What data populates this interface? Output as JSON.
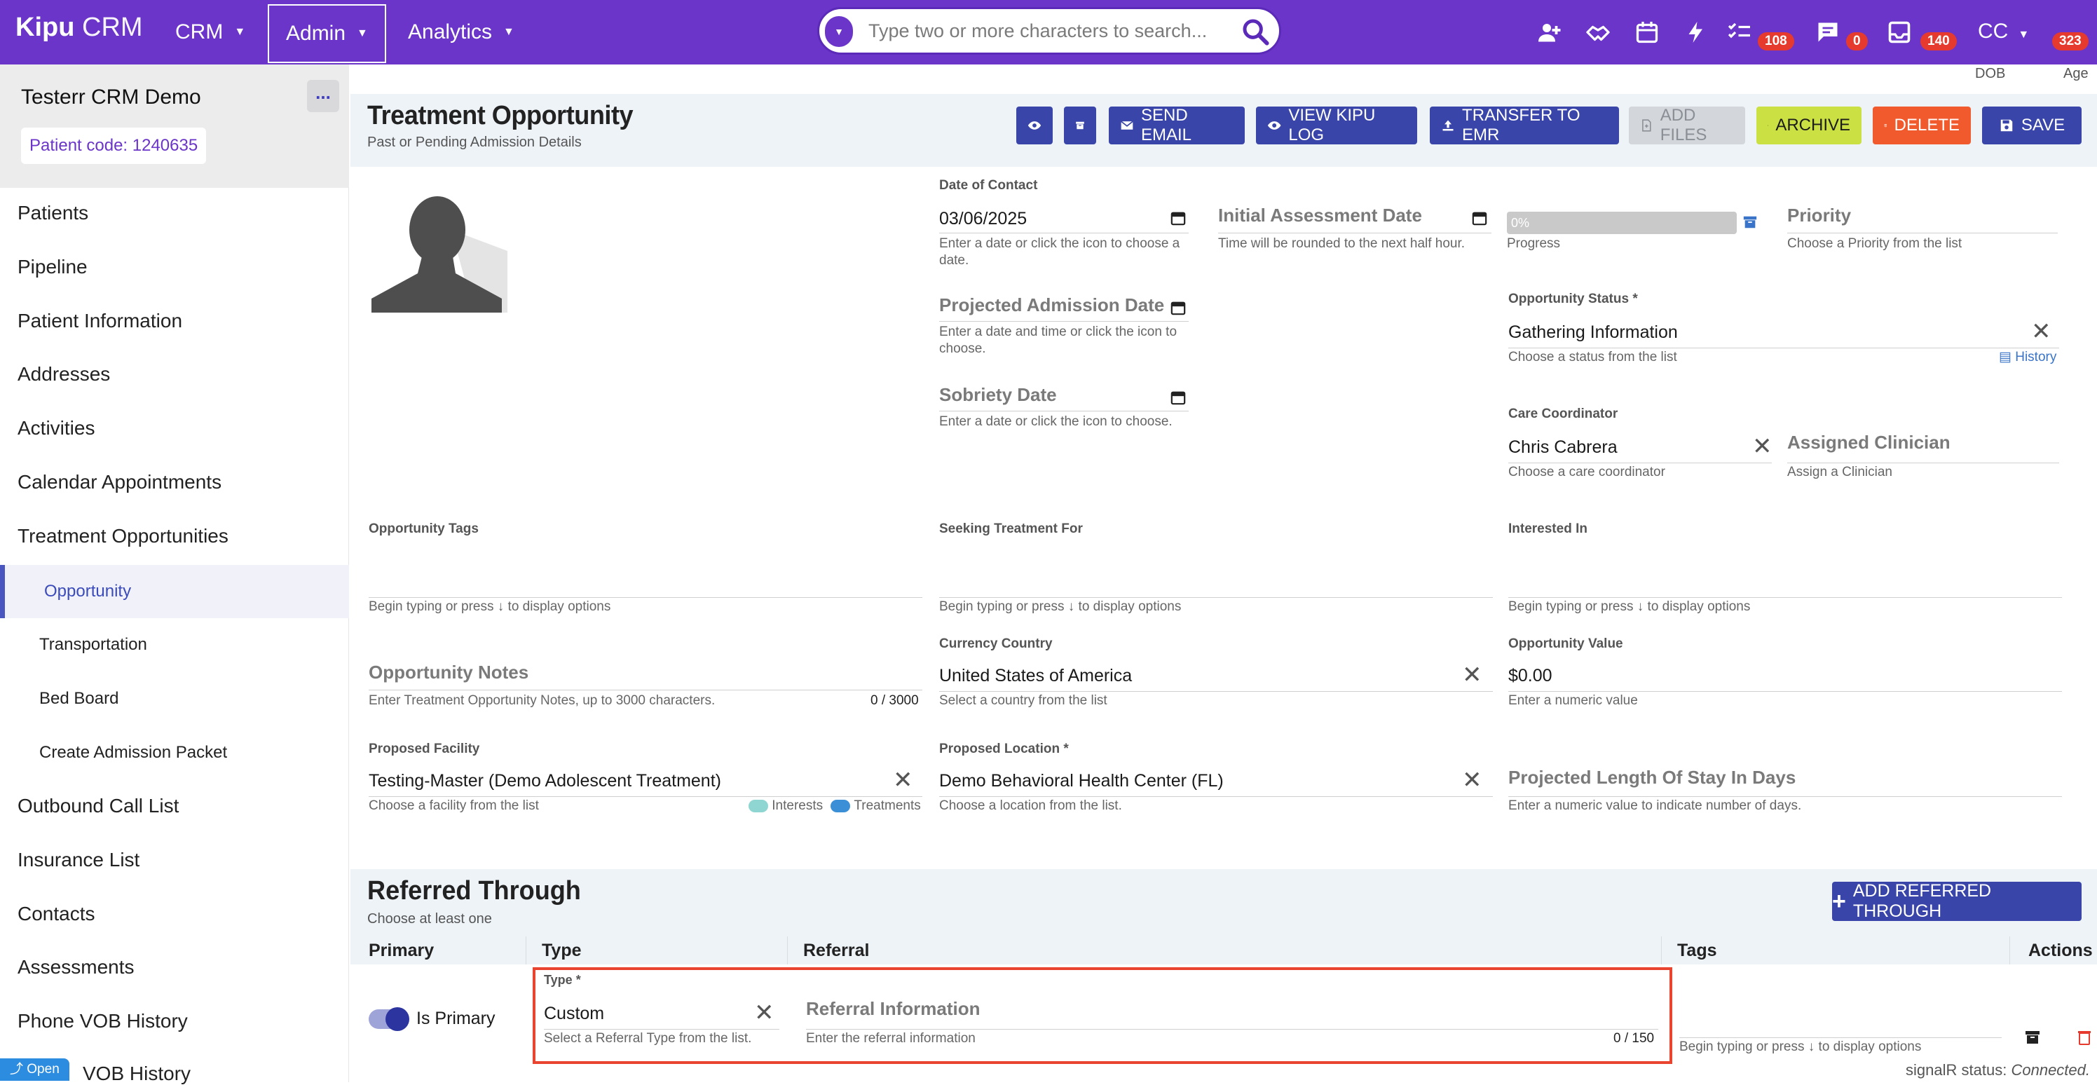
{
  "topbar": {
    "logo_kipu": "Kipu",
    "logo_crm": " CRM",
    "nav": [
      {
        "label": "CRM"
      },
      {
        "label": "Admin"
      },
      {
        "label": "Analytics"
      }
    ],
    "search_placeholder": "Type two or more characters to search...",
    "badges": {
      "tasks": "108",
      "messages": "0",
      "inbox": "140",
      "user": "323"
    },
    "user_initials": "CC"
  },
  "subheader": {
    "dob": "DOB",
    "age": "Age"
  },
  "sidebar": {
    "patient_name": "Testerr CRM Demo",
    "more": "...",
    "patient_code": "Patient code: 1240635",
    "items": [
      "Patients",
      "Pipeline",
      "Patient Information",
      "Addresses",
      "Activities",
      "Calendar Appointments",
      "Treatment Opportunities",
      "Opportunity",
      "Transportation",
      "Bed Board",
      "Create Admission Packet",
      "Outbound Call List",
      "Insurance List",
      "Contacts",
      "Assessments",
      "Phone VOB History",
      "VOB History"
    ],
    "open": "Open"
  },
  "page": {
    "title": "Treatment Opportunity",
    "subtitle": "Past or Pending Admission Details",
    "buttons": {
      "send_email": "SEND EMAIL",
      "view_log": "VIEW KIPU LOG",
      "transfer": "TRANSFER TO EMR",
      "add_files": "ADD FILES",
      "archive": "ARCHIVE",
      "delete": "DELETE",
      "save": "SAVE"
    }
  },
  "form": {
    "date_of_contact": {
      "label": "Date of Contact",
      "value": "03/06/2025",
      "hint": "Enter a date or click the icon to choose a date."
    },
    "initial_assessment": {
      "label": "Initial Assessment Date",
      "hint": "Time will be rounded to the next half hour."
    },
    "progress": {
      "value": "0%",
      "percent": 0,
      "label": "Progress"
    },
    "priority": {
      "label": "Priority",
      "hint": "Choose a Priority from the list"
    },
    "projected_admission": {
      "label": "Projected Admission Date",
      "hint": "Enter a date and time or click the icon to choose."
    },
    "opportunity_status": {
      "label": "Opportunity Status",
      "value": "Gathering Information",
      "hint": "Choose a status from the list",
      "history": "History"
    },
    "sobriety_date": {
      "label": "Sobriety Date",
      "hint": "Enter a date or click the icon to choose."
    },
    "care_coordinator": {
      "label": "Care Coordinator",
      "value": "Chris Cabrera",
      "hint": "Choose a care coordinator"
    },
    "assigned_clinician": {
      "label": "Assigned Clinician",
      "hint": "Assign a Clinician"
    },
    "opportunity_tags": {
      "label": "Opportunity Tags",
      "hint": "Begin typing or press ↓ to display options"
    },
    "seeking_treatment": {
      "label": "Seeking Treatment For",
      "hint": "Begin typing or press ↓ to display options"
    },
    "interested_in": {
      "label": "Interested In",
      "hint": "Begin typing or press ↓ to display options"
    },
    "opportunity_notes": {
      "label": "Opportunity Notes",
      "hint": "Enter Treatment Opportunity Notes, up to 3000 characters.",
      "count": "0 / 3000"
    },
    "currency_country": {
      "label": "Currency Country",
      "value": "United States of America",
      "hint": "Select a country from the list"
    },
    "opportunity_value": {
      "label": "Opportunity Value",
      "value": "$0.00",
      "hint": "Enter a numeric value"
    },
    "proposed_facility": {
      "label": "Proposed Facility",
      "value": "Testing-Master (Demo Adolescent Treatment)",
      "hint": "Choose a facility from the list",
      "legend_interests": "Interests",
      "legend_treatments": "Treatments"
    },
    "proposed_location": {
      "label": "Proposed Location",
      "value": "Demo Behavioral Health Center (FL)",
      "hint": "Choose a location from the list."
    },
    "projected_los": {
      "label": "Projected Length Of Stay In Days",
      "hint": "Enter a numeric value to indicate number of days."
    }
  },
  "referred": {
    "title": "Referred Through",
    "subtitle": "Choose at least one",
    "add_button": "ADD REFERRED THROUGH",
    "columns": [
      "Primary",
      "Type",
      "Referral",
      "Tags",
      "Actions"
    ],
    "row": {
      "primary_label": "Is Primary",
      "type_label": "Type",
      "type_value": "Custom",
      "type_hint": "Select a Referral Type from the list.",
      "referral_label": "Referral Information",
      "referral_hint": "Enter the referral information",
      "referral_count": "0 / 150",
      "tags_hint": "Begin typing or press ↓ to display options"
    }
  },
  "status": {
    "label": "signalR status:",
    "value": "Connected."
  },
  "colors": {
    "brand": "#6a35c8",
    "navy": "#3945a8",
    "lime": "#cbe043",
    "orange": "#f05a2c",
    "badge": "#e63a2e"
  }
}
